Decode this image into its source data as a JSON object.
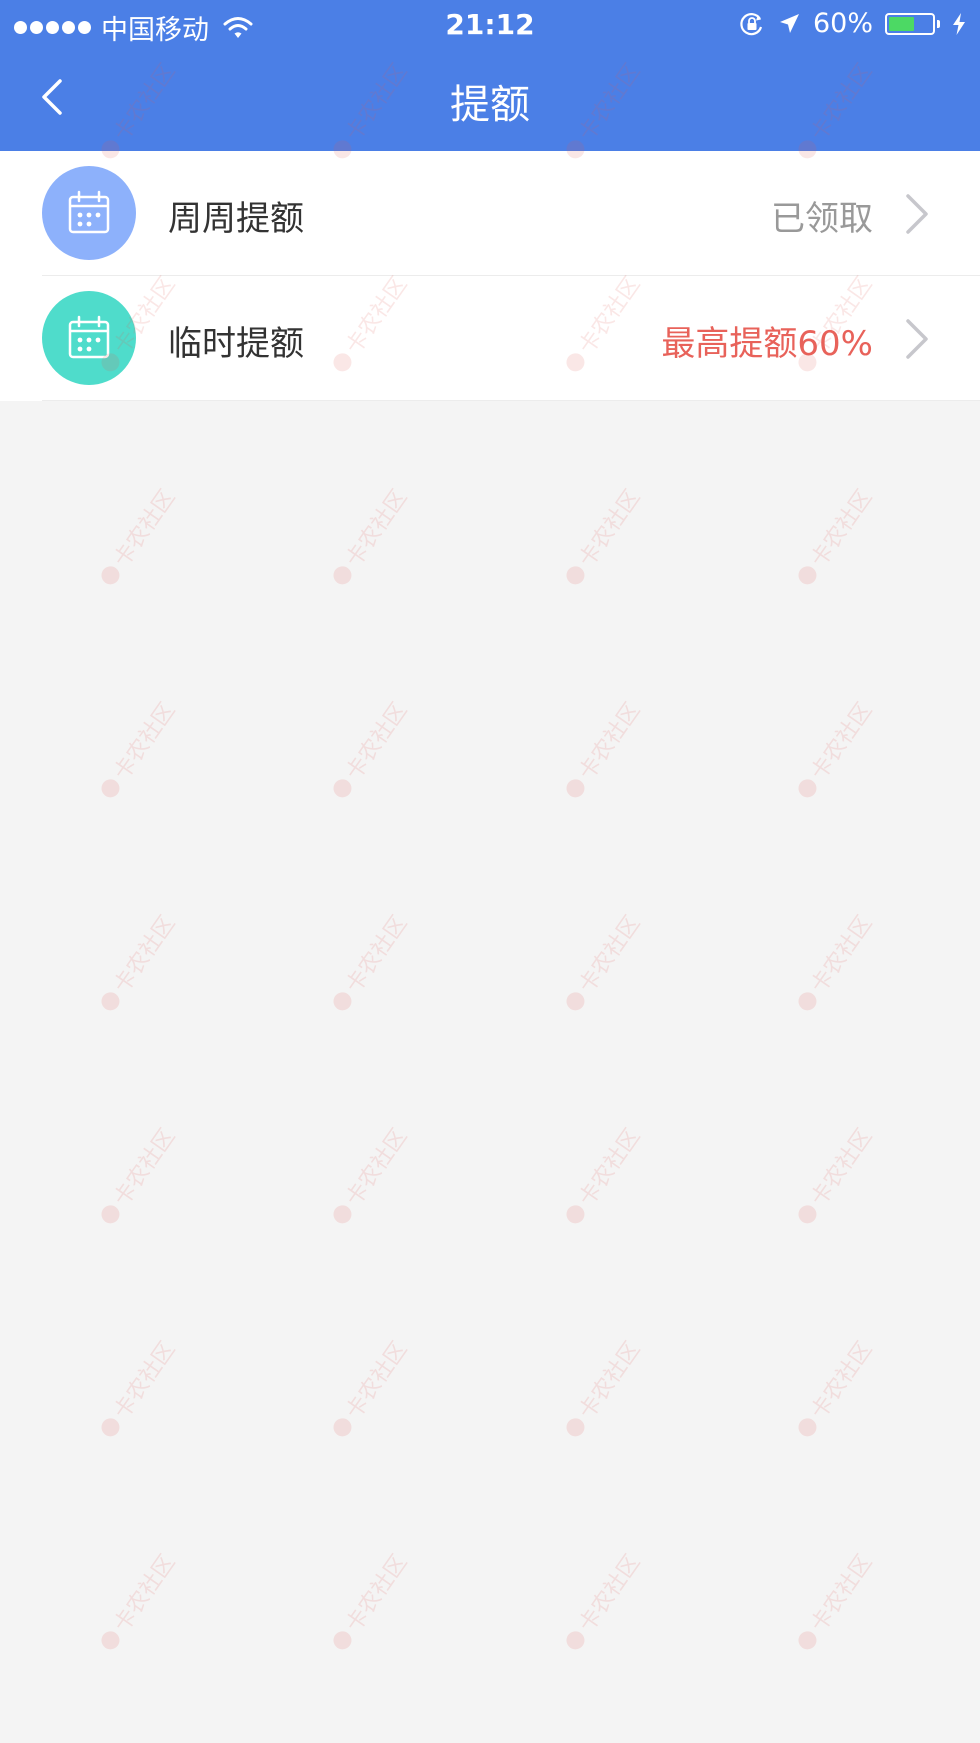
{
  "status_bar": {
    "carrier": "中国移动",
    "time": "21:12",
    "battery_percent": "60%",
    "battery_level": 0.6
  },
  "nav": {
    "title": "提额",
    "back_icon": "chevron-left-icon"
  },
  "items": [
    {
      "label": "周周提额",
      "status": "已领取",
      "icon": "calendar-icon",
      "icon_bg": "#8db1fb",
      "status_color": "#999999"
    },
    {
      "label": "临时提额",
      "status": "最高提额60%",
      "icon": "calendar-icon",
      "icon_bg": "#4fdccb",
      "status_color": "#e8625a"
    }
  ],
  "colors": {
    "header_bg": "#4b7fe6",
    "page_bg": "#f4f4f4",
    "chevron": "#c7c7cc"
  },
  "watermark": "卡农社区"
}
